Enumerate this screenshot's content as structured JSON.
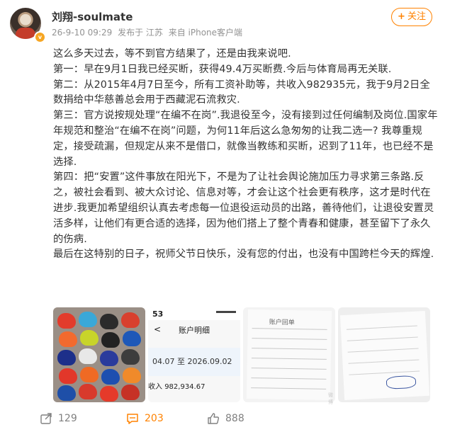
{
  "post": {
    "username": "刘翔-soulmate",
    "date": "26-9-10 09:29",
    "from_location": "发布于 江苏",
    "client": "来自 iPhone客户端",
    "follow_label": "关注",
    "paragraphs": [
      "这么多天过去，等不到官方结果了，还是由我来说吧.",
      "第一：早在9月1日我已经买断，获得49.4万买断费.今后与体育局再无关联.",
      "第二：从2015年4月7日至今，所有工资补助等，共收入982935元，我于9月2日全数捐给中华慈善总会用于西藏泥石流救灾.",
      "第三：官方说按规处理“在编不在岗”.我退役至今，没有接到过任何编制及岗位.国家年年规范和整治“在编不在岗”问题，为何11年后这么急匆匆的让我二选一? 我尊重规定，接受疏漏，但规定从来不是借口，就像当教练和买断，迟到了11年，也已经不是选择.",
      "第四：把“安置”这件事放在阳光下，不是为了让社会舆论施加压力寻求第三条路.反之，被社会看到、被大众讨论、信息对等，才会让这个社会更有秩序，这才是时代在进步.我更加希望组织认真去考虑每一位退役运动员的出路，善待他们，让退役安置灵活多样，让他们有更合适的选择，因为他们搭上了整个青春和健康，甚至留下了永久的伤病.",
      "最后在这特别的日子，祝师父节日快乐，没有您的付出，也没有中国跨栏今天的辉煌."
    ]
  },
  "photos": {
    "bank": {
      "status_time": "53",
      "title": "账户明细",
      "back": "<",
      "date_range": "04.07 至 2026.09.02",
      "income_label": "收入",
      "income_value": "982,934.67"
    },
    "doc": {
      "title": "账户回单"
    },
    "watermark": "微博"
  },
  "actions": {
    "repost_count": "129",
    "comment_count": "203",
    "like_count": "888"
  },
  "colors": {
    "accent": "#ff8200",
    "meta_gray": "#939393",
    "text": "#333333"
  }
}
